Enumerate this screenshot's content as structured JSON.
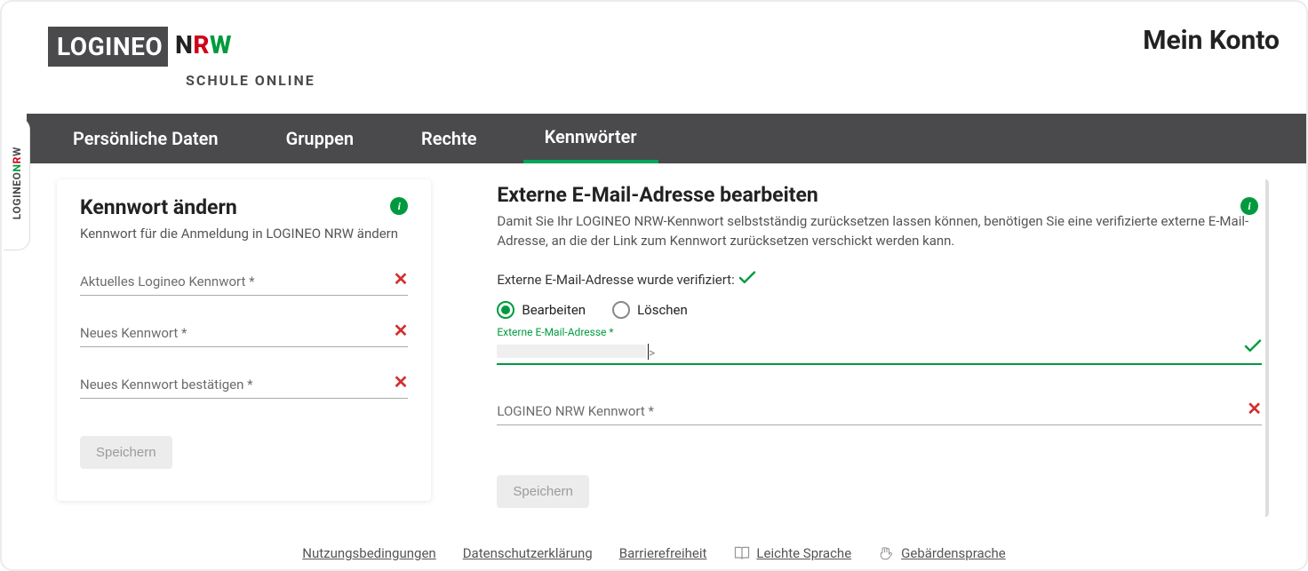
{
  "brand": {
    "logineo": "LOGINEO",
    "nrw_n": "N",
    "nrw_r": "R",
    "nrw_w": "W",
    "subline": "SCHULE ONLINE"
  },
  "page_title": "Mein Konto",
  "tabs": [
    "Persönliche Daten",
    "Gruppen",
    "Rechte",
    "Kennwörter"
  ],
  "active_tab_index": 3,
  "side_tab": {
    "logineo": "LOGINEO",
    "n": "N",
    "r": "R",
    "w": "W"
  },
  "left_card": {
    "title": "Kennwort ändern",
    "sub": "Kennwort für die Anmeldung in LOGINEO NRW ändern",
    "fields": {
      "current": "Aktuelles Logineo Kennwort *",
      "new": "Neues Kennwort *",
      "confirm": "Neues Kennwort bestätigen *"
    },
    "save": "Speichern",
    "info_glyph": "i"
  },
  "right_card": {
    "title": "Externe E-Mail-Adresse bearbeiten",
    "sub": "Damit Sie Ihr LOGINEO NRW-Kennwort selbstständig zurücksetzen lassen können, benötigen Sie eine verifizierte externe E-Mail-Adresse, an die der Link zum Kennwort zurücksetzen verschickt werden kann.",
    "verified_line": "Externe E-Mail-Adresse wurde verifiziert:",
    "radio_edit": "Bearbeiten",
    "radio_delete": "Löschen",
    "float_label": "Externe E-Mail-Adresse *",
    "password_label": "LOGINEO NRW Kennwort *",
    "save": "Speichern",
    "info_glyph": "i"
  },
  "footer": {
    "nutzung": "Nutzungsbedingungen",
    "datenschutz": "Datenschutzerklärung",
    "barriere": "Barrierefreiheit",
    "leichte": "Leichte Sprache",
    "gebaerden": "Gebärdensprache"
  }
}
